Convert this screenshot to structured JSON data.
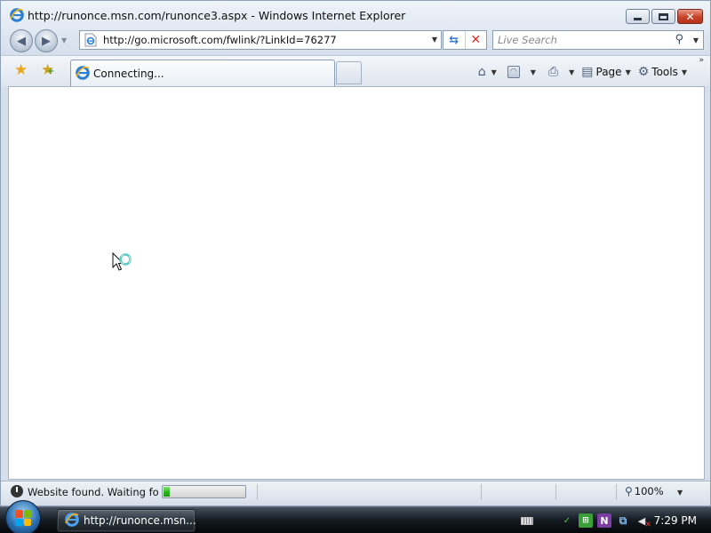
{
  "window": {
    "title": "http://runonce.msn.com/runonce3.aspx - Windows Internet Explorer",
    "caption_buttons": {
      "minimize": "minimize",
      "maximize": "maximize",
      "close": "close"
    }
  },
  "nav": {
    "address_value": "http://go.microsoft.com/fwlink/?LinkId=76277",
    "search_placeholder": "Live Search"
  },
  "tabs": [
    {
      "label": "Connecting...",
      "active": true
    }
  ],
  "commands": {
    "page_label": "Page",
    "tools_label": "Tools"
  },
  "status": {
    "text": "Website found. Waiting for reply...",
    "progress": 0.07,
    "zoom": "100%"
  },
  "taskbar": {
    "task_label": "http://runonce.msn...",
    "clock": "7:29 PM"
  },
  "colors": {
    "progress_fill": "#29b21b",
    "close_button": "#c7432a",
    "ie_icon_blue": "#2a7fd4",
    "ie_ring_gold": "#f0b21c"
  },
  "icons": [
    "ie-icon",
    "back-arrow-icon",
    "forward-arrow-icon",
    "refresh-icon",
    "stop-icon",
    "search-icon",
    "favorites-star-icon",
    "add-favorites-icon",
    "home-icon",
    "feeds-icon",
    "print-icon",
    "page-icon",
    "gear-icon",
    "busy-cursor-icon",
    "clock-icon",
    "zoom-icon",
    "windows-start-icon",
    "keyboard-icon",
    "volume-muted-icon",
    "network-icon",
    "onenote-icon"
  ]
}
